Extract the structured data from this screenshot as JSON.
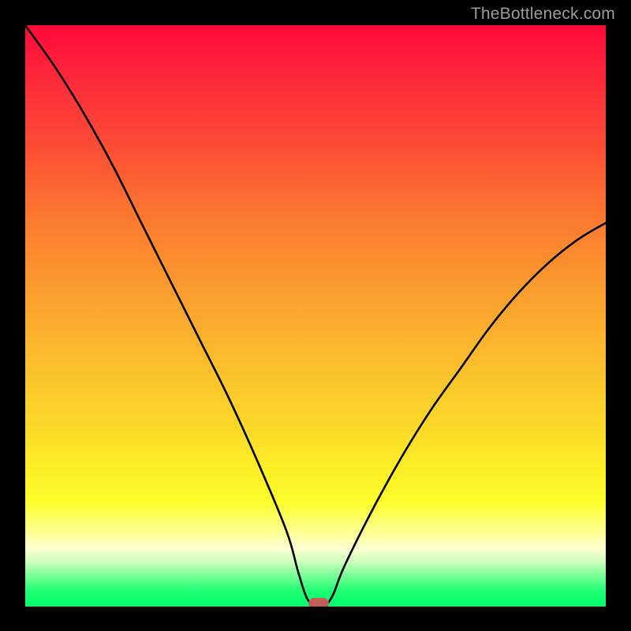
{
  "watermark": "TheBottleneck.com",
  "chart_data": {
    "type": "line",
    "title": "",
    "xlabel": "",
    "ylabel": "",
    "xlim": [
      0,
      100
    ],
    "ylim": [
      0,
      100
    ],
    "grid": false,
    "legend": false,
    "series": [
      {
        "name": "bottleneck-curve",
        "x": [
          0,
          5,
          10,
          15,
          20,
          25,
          30,
          35,
          40,
          45,
          47,
          48.5,
          50,
          51.5,
          53,
          55,
          60,
          65,
          70,
          75,
          80,
          85,
          90,
          95,
          100
        ],
        "values": [
          100,
          93,
          85,
          76,
          66,
          56,
          46,
          36,
          25,
          13,
          6,
          1.5,
          0,
          0,
          2,
          7,
          17,
          26,
          34,
          41,
          48,
          54,
          59,
          63,
          66
        ]
      }
    ],
    "marker": {
      "x": 50.5,
      "y": 0,
      "label": "optimal-point"
    },
    "background_gradient": {
      "top_color": "#ff0a3b",
      "mid_color": "#fbdb28",
      "bottom_color": "#02fe6c"
    }
  }
}
